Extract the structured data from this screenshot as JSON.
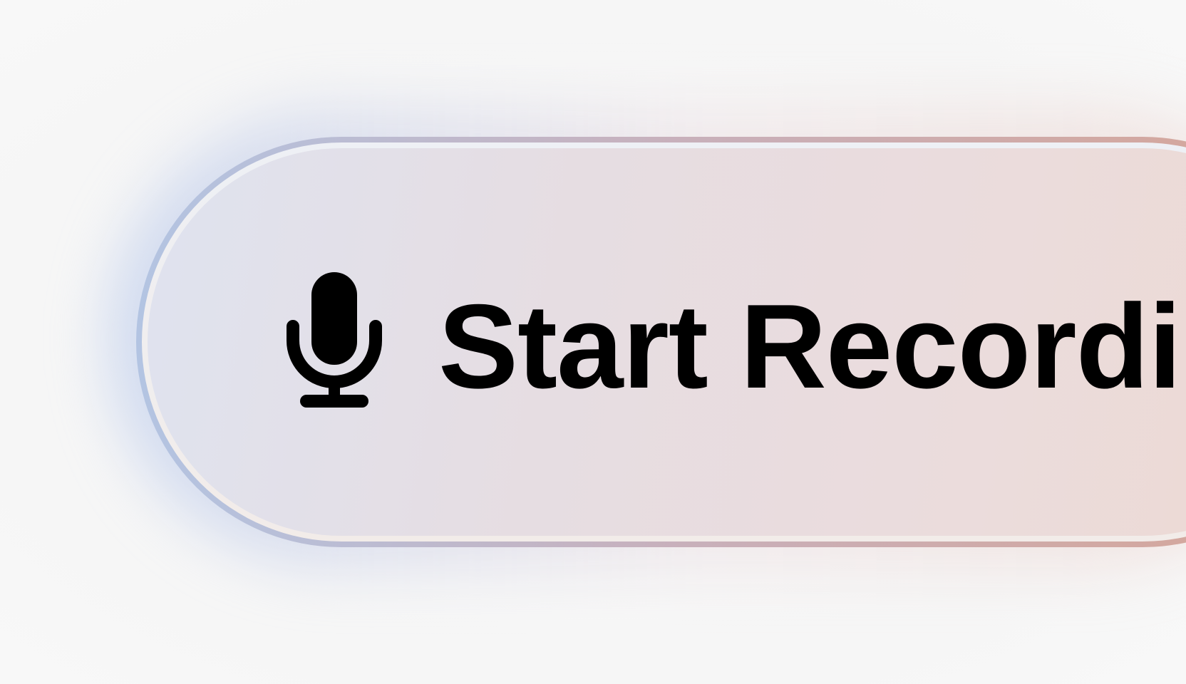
{
  "record_button": {
    "label": "Start Recording",
    "icon": "microphone-icon"
  },
  "colors": {
    "background": "#f8f8f8",
    "border_start": "#b3c4e2",
    "border_end": "#d7a596",
    "text": "#000000"
  }
}
